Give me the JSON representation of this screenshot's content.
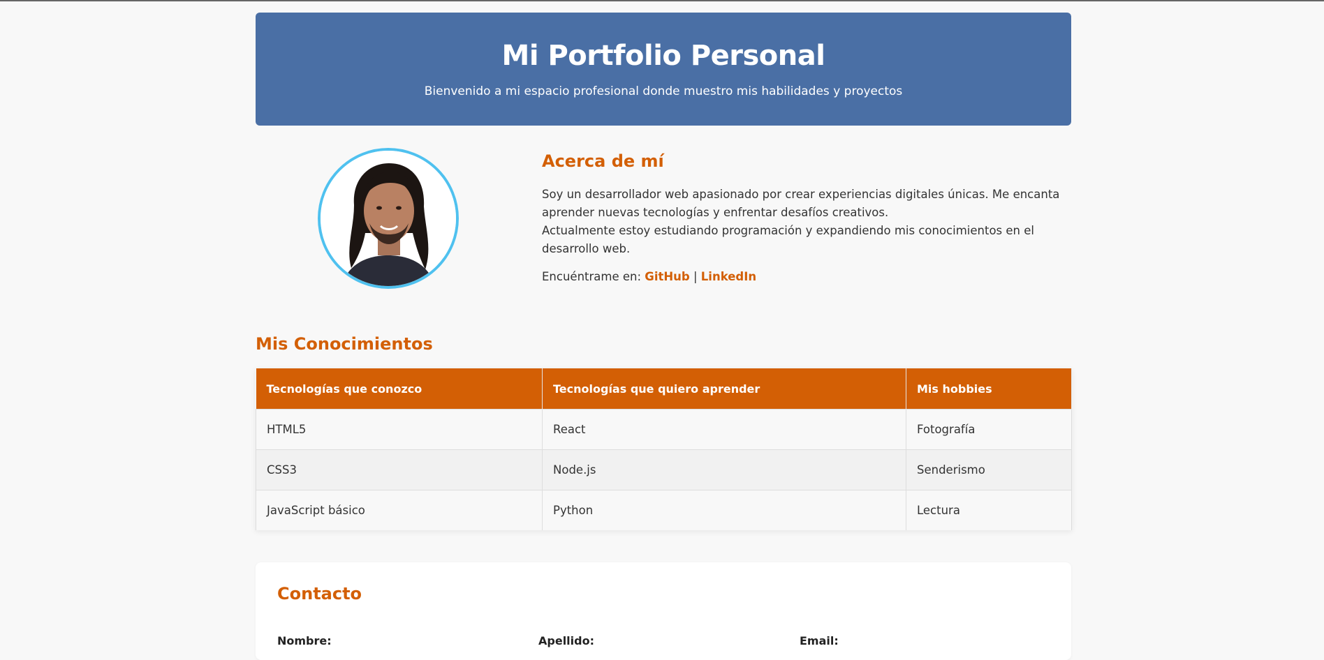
{
  "header": {
    "title": "Mi Portfolio Personal",
    "subtitle": "Bienvenido a mi espacio profesional donde muestro mis habilidades y proyectos"
  },
  "about": {
    "title": "Acerca de mí",
    "paragraph1": "Soy un desarrollador web apasionado por crear experiencias digitales únicas. Me encanta aprender nuevas tecnologías y enfrentar desafíos creativos.",
    "paragraph2": "Actualmente estoy estudiando programación y expandiendo mis conocimientos en el desarrollo web.",
    "social_prefix": "Encuéntrame en:",
    "separator": "|",
    "links": {
      "github": "GitHub",
      "linkedin": "LinkedIn"
    }
  },
  "skills": {
    "title": "Mis Conocimientos",
    "headers": [
      "Tecnologías que conozco",
      "Tecnologías que quiero aprender",
      "Mis hobbies"
    ],
    "rows": [
      [
        "HTML5",
        "React",
        "Fotografía"
      ],
      [
        "CSS3",
        "Node.js",
        "Senderismo"
      ],
      [
        "JavaScript básico",
        "Python",
        "Lectura"
      ]
    ]
  },
  "contact": {
    "title": "Contacto",
    "labels": {
      "nombre": "Nombre:",
      "apellido": "Apellido:",
      "email": "Email:"
    }
  },
  "colors": {
    "header_bg": "#4a6fa5",
    "accent": "#d35f05",
    "avatar_border": "#4fc1ef",
    "page_bg": "#f8f8f8"
  }
}
